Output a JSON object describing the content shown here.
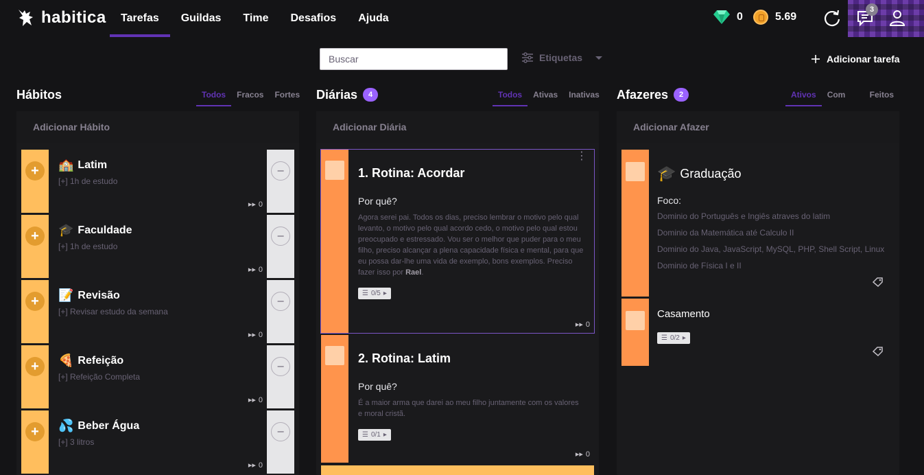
{
  "app": {
    "brand": "habitica",
    "nav": [
      "Tarefas",
      "Guildas",
      "Time",
      "Desafios",
      "Ajuda"
    ],
    "gems": "0",
    "gold": "5.69",
    "notifications": "3"
  },
  "toolbar": {
    "search_placeholder": "Buscar",
    "tags_label": "Etiquetas",
    "add_task_label": "Adicionar tarefa"
  },
  "habits": {
    "title": "Hábitos",
    "filters": [
      "Todos",
      "Fracos",
      "Fortes"
    ],
    "quick_add": "Adicionar Hábito",
    "items": [
      {
        "emoji": "🏫",
        "title": "Latim",
        "note": "[+] 1h de estudo",
        "streak": "0"
      },
      {
        "emoji": "🎓",
        "title": "Faculdade",
        "note": "[+] 1h de estudo",
        "streak": "0"
      },
      {
        "emoji": "📝",
        "title": "Revisão",
        "note": "[+] Revisar estudo da semana",
        "streak": "0"
      },
      {
        "emoji": "🍕",
        "title": "Refeição",
        "note": "[+] Refeição Completa",
        "streak": "0"
      },
      {
        "emoji": "💦",
        "title": "Beber Água",
        "note": "[+] 3 litros",
        "streak": "0"
      }
    ]
  },
  "dailies": {
    "title": "Diárias",
    "count": "4",
    "filters": [
      "Todos",
      "Ativas",
      "Inativas"
    ],
    "quick_add": "Adicionar Diária",
    "items": [
      {
        "title": "1. Rotina: Acordar",
        "subheading": "Por quê?",
        "text": "Agora serei pai. Todos os dias, preciso lembrar o motivo pelo qual levanto, o motivo pelo qual acordo cedo, o motivo pelo qual estou preocupado e estressado. Vou ser o melhor que puder para o meu filho, preciso alcançar a plena capacidade física e mental, para que eu possa dar-lhe uma vida de exemplo, bons exemplos. Preciso fazer isso por",
        "text_bold": "Rael",
        "checklist": "0/5",
        "streak": "0"
      },
      {
        "title": "2. Rotina: Latim",
        "subheading": "Por quê?",
        "text": "É a maior arma que darei ao meu filho juntamente com os valores e moral cristã.",
        "checklist": "0/1",
        "streak": "0"
      }
    ]
  },
  "todos": {
    "title": "Afazeres",
    "count": "2",
    "filters": [
      "Ativos",
      "Com data",
      "Feitos"
    ],
    "quick_add": "Adicionar Afazer",
    "items": [
      {
        "emoji": "🎓",
        "title": "Graduação",
        "subheading": "Foco:",
        "lines": [
          "Dominio do Português e Ingiês atraves do latim",
          "Dominio da Matemática até Calculo II",
          "Dominio do Java, JavaScript, MySQL, PHP, Shell Script, Linux",
          "Dominio de Física I e II"
        ]
      },
      {
        "title": "Casamento",
        "checklist": "0/2"
      }
    ]
  },
  "colors": {
    "accent": "#6133b4",
    "habit_yellow": "#ffbe5d",
    "orange": "#ff944c",
    "background": "#141416"
  }
}
